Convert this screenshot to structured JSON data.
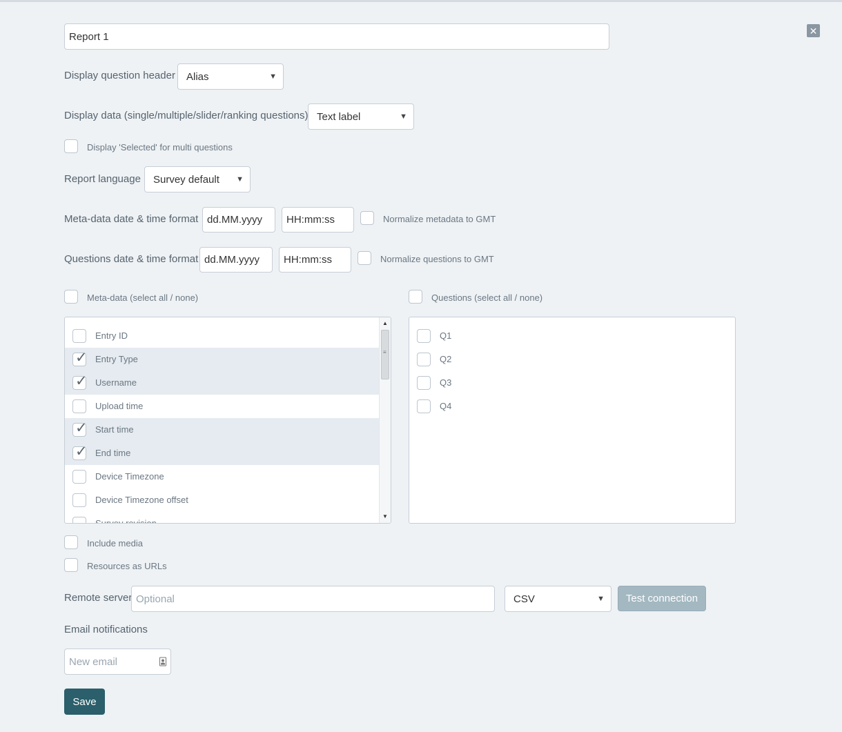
{
  "report": {
    "name": "Report 1"
  },
  "display_question_header": {
    "label": "Display question header",
    "value": "Alias"
  },
  "display_data": {
    "label": "Display data (single/multiple/slider/ranking questions)",
    "value": "Text label"
  },
  "display_selected": {
    "label": "Display 'Selected' for multi questions",
    "checked": false
  },
  "report_language": {
    "label": "Report language",
    "value": "Survey default"
  },
  "metadata_datetime": {
    "label": "Meta-data date & time format",
    "date": "dd.MM.yyyy",
    "time": "HH:mm:ss",
    "normalize_label": "Normalize metadata to GMT"
  },
  "questions_datetime": {
    "label": "Questions date & time format",
    "date": "dd.MM.yyyy",
    "time": "HH:mm:ss",
    "normalize_label": "Normalize questions to GMT"
  },
  "metadata": {
    "select_all_label": "Meta-data (select all / none)",
    "items": [
      {
        "label": "Entry ID",
        "checked": false
      },
      {
        "label": "Entry Type",
        "checked": true
      },
      {
        "label": "Username",
        "checked": true
      },
      {
        "label": "Upload time",
        "checked": false
      },
      {
        "label": "Start time",
        "checked": true
      },
      {
        "label": "End time",
        "checked": true
      },
      {
        "label": "Device Timezone",
        "checked": false
      },
      {
        "label": "Device Timezone offset",
        "checked": false
      },
      {
        "label": "Survey revision",
        "checked": false
      }
    ]
  },
  "questions": {
    "select_all_label": "Questions (select all / none)",
    "items": [
      {
        "label": "Q1",
        "checked": false
      },
      {
        "label": "Q2",
        "checked": false
      },
      {
        "label": "Q3",
        "checked": false
      },
      {
        "label": "Q4",
        "checked": false
      }
    ]
  },
  "include_media": {
    "label": "Include media",
    "checked": false
  },
  "resources_as_urls": {
    "label": "Resources as URLs",
    "checked": false
  },
  "remote_server": {
    "label": "Remote server",
    "placeholder": "Optional",
    "format": "CSV",
    "test_label": "Test connection"
  },
  "email": {
    "label": "Email notifications",
    "placeholder": "New email"
  },
  "save_label": "Save",
  "icons": {
    "close": "close-icon",
    "dropdown": "chevron-down-icon",
    "contact": "contact-card-icon"
  }
}
